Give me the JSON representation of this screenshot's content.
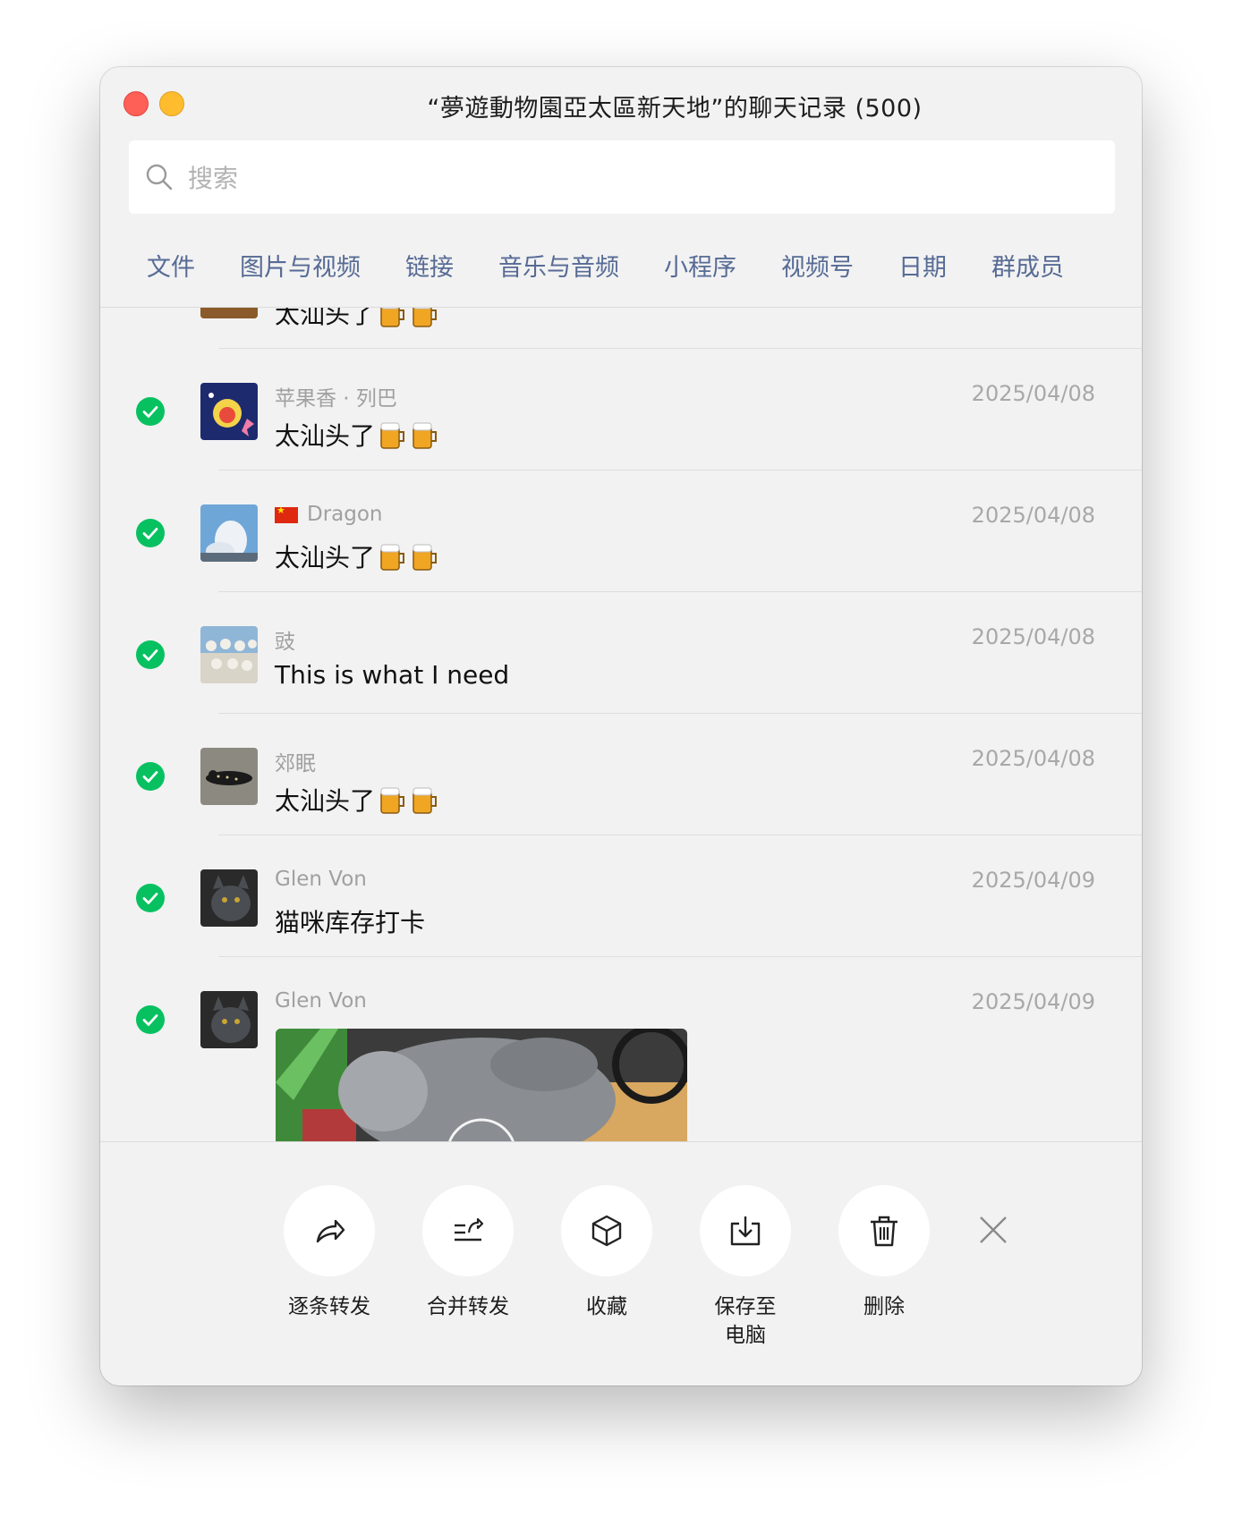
{
  "window": {
    "title": "“夢遊動物園亞太區新天地”的聊天记录 (500)"
  },
  "search": {
    "placeholder": "搜索"
  },
  "filters": [
    "文件",
    "图片与视频",
    "链接",
    "音乐与音频",
    "小程序",
    "视频号",
    "日期",
    "群成员"
  ],
  "partial_row": {
    "text": "太汕头了"
  },
  "messages": [
    {
      "sender": "苹果香 · 列巴",
      "date": "2025/04/08",
      "text": "太汕头了",
      "beers": 2,
      "avatar": "cartoon-avatar"
    },
    {
      "sender": "Dragon",
      "date": "2025/04/08",
      "text": "太汕头了",
      "beers": 2,
      "flag": "china-flag",
      "avatar": "cloud-avatar"
    },
    {
      "sender": "豉",
      "date": "2025/04/08",
      "text": "This is what I need",
      "beers": 0,
      "avatar": "group-photo-avatar"
    },
    {
      "sender": "郊眠",
      "date": "2025/04/08",
      "text": "太汕头了",
      "beers": 2,
      "avatar": "leopard-avatar"
    },
    {
      "sender": "Glen Von",
      "date": "2025/04/09",
      "text": "猫咪库存打卡",
      "beers": 0,
      "avatar": "cat-avatar"
    },
    {
      "sender": "Glen Von",
      "date": "2025/04/09",
      "text": "",
      "media": "cat-video-thumbnail",
      "avatar": "cat-avatar"
    }
  ],
  "actions": [
    {
      "label": "逐条转发",
      "icon": "forward-icon"
    },
    {
      "label": "合并转发",
      "icon": "merge-forward-icon"
    },
    {
      "label": "收藏",
      "icon": "box-icon"
    },
    {
      "label": "保存至\n电脑",
      "icon": "download-icon"
    },
    {
      "label": "删除",
      "icon": "trash-icon"
    }
  ],
  "colors": {
    "accent_link": "#576b95",
    "check_green": "#07c160",
    "window_bg": "#f2f2f2"
  }
}
